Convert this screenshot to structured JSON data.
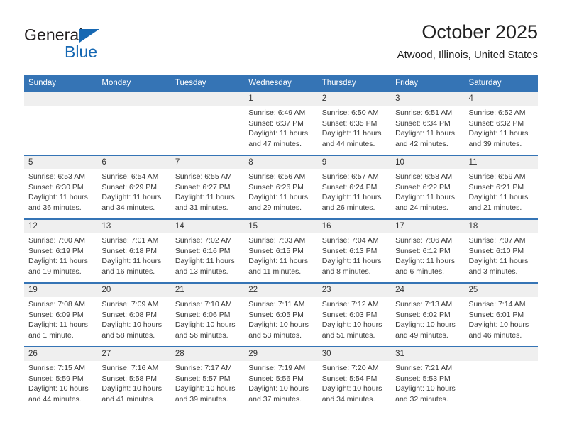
{
  "brand": {
    "name_part1": "General",
    "name_part2": "Blue",
    "accent_color": "#1668b3"
  },
  "header": {
    "title": "October 2025",
    "subtitle": "Atwood, Illinois, United States"
  },
  "theme": {
    "header_row_bg": "#3574b5",
    "daynum_bg": "#efefef",
    "separator": "#3574b5"
  },
  "labels": {
    "sunrise_prefix": "Sunrise:",
    "sunset_prefix": "Sunset:",
    "daylight_prefix": "Daylight:"
  },
  "weekdays": [
    "Sunday",
    "Monday",
    "Tuesday",
    "Wednesday",
    "Thursday",
    "Friday",
    "Saturday"
  ],
  "weeks": [
    [
      {
        "day": "",
        "empty": true
      },
      {
        "day": "",
        "empty": true
      },
      {
        "day": "",
        "empty": true
      },
      {
        "day": "1",
        "sunrise": "Sunrise: 6:49 AM",
        "sunset": "Sunset: 6:37 PM",
        "daylight": "Daylight: 11 hours and 47 minutes."
      },
      {
        "day": "2",
        "sunrise": "Sunrise: 6:50 AM",
        "sunset": "Sunset: 6:35 PM",
        "daylight": "Daylight: 11 hours and 44 minutes."
      },
      {
        "day": "3",
        "sunrise": "Sunrise: 6:51 AM",
        "sunset": "Sunset: 6:34 PM",
        "daylight": "Daylight: 11 hours and 42 minutes."
      },
      {
        "day": "4",
        "sunrise": "Sunrise: 6:52 AM",
        "sunset": "Sunset: 6:32 PM",
        "daylight": "Daylight: 11 hours and 39 minutes."
      }
    ],
    [
      {
        "day": "5",
        "sunrise": "Sunrise: 6:53 AM",
        "sunset": "Sunset: 6:30 PM",
        "daylight": "Daylight: 11 hours and 36 minutes."
      },
      {
        "day": "6",
        "sunrise": "Sunrise: 6:54 AM",
        "sunset": "Sunset: 6:29 PM",
        "daylight": "Daylight: 11 hours and 34 minutes."
      },
      {
        "day": "7",
        "sunrise": "Sunrise: 6:55 AM",
        "sunset": "Sunset: 6:27 PM",
        "daylight": "Daylight: 11 hours and 31 minutes."
      },
      {
        "day": "8",
        "sunrise": "Sunrise: 6:56 AM",
        "sunset": "Sunset: 6:26 PM",
        "daylight": "Daylight: 11 hours and 29 minutes."
      },
      {
        "day": "9",
        "sunrise": "Sunrise: 6:57 AM",
        "sunset": "Sunset: 6:24 PM",
        "daylight": "Daylight: 11 hours and 26 minutes."
      },
      {
        "day": "10",
        "sunrise": "Sunrise: 6:58 AM",
        "sunset": "Sunset: 6:22 PM",
        "daylight": "Daylight: 11 hours and 24 minutes."
      },
      {
        "day": "11",
        "sunrise": "Sunrise: 6:59 AM",
        "sunset": "Sunset: 6:21 PM",
        "daylight": "Daylight: 11 hours and 21 minutes."
      }
    ],
    [
      {
        "day": "12",
        "sunrise": "Sunrise: 7:00 AM",
        "sunset": "Sunset: 6:19 PM",
        "daylight": "Daylight: 11 hours and 19 minutes."
      },
      {
        "day": "13",
        "sunrise": "Sunrise: 7:01 AM",
        "sunset": "Sunset: 6:18 PM",
        "daylight": "Daylight: 11 hours and 16 minutes."
      },
      {
        "day": "14",
        "sunrise": "Sunrise: 7:02 AM",
        "sunset": "Sunset: 6:16 PM",
        "daylight": "Daylight: 11 hours and 13 minutes."
      },
      {
        "day": "15",
        "sunrise": "Sunrise: 7:03 AM",
        "sunset": "Sunset: 6:15 PM",
        "daylight": "Daylight: 11 hours and 11 minutes."
      },
      {
        "day": "16",
        "sunrise": "Sunrise: 7:04 AM",
        "sunset": "Sunset: 6:13 PM",
        "daylight": "Daylight: 11 hours and 8 minutes."
      },
      {
        "day": "17",
        "sunrise": "Sunrise: 7:06 AM",
        "sunset": "Sunset: 6:12 PM",
        "daylight": "Daylight: 11 hours and 6 minutes."
      },
      {
        "day": "18",
        "sunrise": "Sunrise: 7:07 AM",
        "sunset": "Sunset: 6:10 PM",
        "daylight": "Daylight: 11 hours and 3 minutes."
      }
    ],
    [
      {
        "day": "19",
        "sunrise": "Sunrise: 7:08 AM",
        "sunset": "Sunset: 6:09 PM",
        "daylight": "Daylight: 11 hours and 1 minute."
      },
      {
        "day": "20",
        "sunrise": "Sunrise: 7:09 AM",
        "sunset": "Sunset: 6:08 PM",
        "daylight": "Daylight: 10 hours and 58 minutes."
      },
      {
        "day": "21",
        "sunrise": "Sunrise: 7:10 AM",
        "sunset": "Sunset: 6:06 PM",
        "daylight": "Daylight: 10 hours and 56 minutes."
      },
      {
        "day": "22",
        "sunrise": "Sunrise: 7:11 AM",
        "sunset": "Sunset: 6:05 PM",
        "daylight": "Daylight: 10 hours and 53 minutes."
      },
      {
        "day": "23",
        "sunrise": "Sunrise: 7:12 AM",
        "sunset": "Sunset: 6:03 PM",
        "daylight": "Daylight: 10 hours and 51 minutes."
      },
      {
        "day": "24",
        "sunrise": "Sunrise: 7:13 AM",
        "sunset": "Sunset: 6:02 PM",
        "daylight": "Daylight: 10 hours and 49 minutes."
      },
      {
        "day": "25",
        "sunrise": "Sunrise: 7:14 AM",
        "sunset": "Sunset: 6:01 PM",
        "daylight": "Daylight: 10 hours and 46 minutes."
      }
    ],
    [
      {
        "day": "26",
        "sunrise": "Sunrise: 7:15 AM",
        "sunset": "Sunset: 5:59 PM",
        "daylight": "Daylight: 10 hours and 44 minutes."
      },
      {
        "day": "27",
        "sunrise": "Sunrise: 7:16 AM",
        "sunset": "Sunset: 5:58 PM",
        "daylight": "Daylight: 10 hours and 41 minutes."
      },
      {
        "day": "28",
        "sunrise": "Sunrise: 7:17 AM",
        "sunset": "Sunset: 5:57 PM",
        "daylight": "Daylight: 10 hours and 39 minutes."
      },
      {
        "day": "29",
        "sunrise": "Sunrise: 7:19 AM",
        "sunset": "Sunset: 5:56 PM",
        "daylight": "Daylight: 10 hours and 37 minutes."
      },
      {
        "day": "30",
        "sunrise": "Sunrise: 7:20 AM",
        "sunset": "Sunset: 5:54 PM",
        "daylight": "Daylight: 10 hours and 34 minutes."
      },
      {
        "day": "31",
        "sunrise": "Sunrise: 7:21 AM",
        "sunset": "Sunset: 5:53 PM",
        "daylight": "Daylight: 10 hours and 32 minutes."
      },
      {
        "day": "",
        "empty": true
      }
    ]
  ]
}
